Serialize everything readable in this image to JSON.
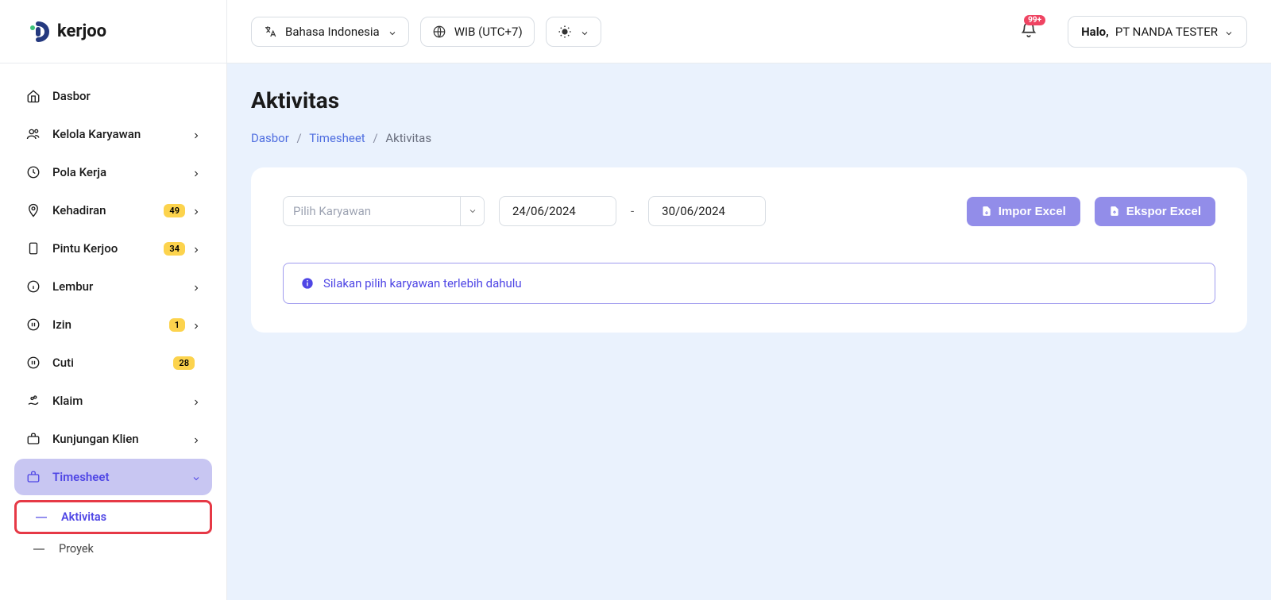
{
  "logo": {
    "text": "kerjoo"
  },
  "sidebar": {
    "items": [
      {
        "label": "Dasbor"
      },
      {
        "label": "Kelola Karyawan"
      },
      {
        "label": "Pola Kerja"
      },
      {
        "label": "Kehadiran",
        "badge": "49"
      },
      {
        "label": "Pintu Kerjoo",
        "badge": "34"
      },
      {
        "label": "Lembur"
      },
      {
        "label": "Izin",
        "badge": "1"
      },
      {
        "label": "Cuti",
        "badge": "28"
      },
      {
        "label": "Klaim"
      },
      {
        "label": "Kunjungan Klien"
      },
      {
        "label": "Timesheet"
      }
    ],
    "sub": {
      "aktivitas": "Aktivitas",
      "proyek": "Proyek"
    }
  },
  "topbar": {
    "language": "Bahasa Indonesia",
    "timezone": "WIB (UTC+7)",
    "notif_badge": "99+",
    "greeting": "Halo,",
    "company": "PT NANDA TESTER"
  },
  "page": {
    "title": "Aktivitas",
    "breadcrumb": {
      "dasbor": "Dasbor",
      "timesheet": "Timesheet",
      "aktivitas": "Aktivitas"
    },
    "filters": {
      "employee_placeholder": "Pilih Karyawan",
      "date_start": "24/06/2024",
      "date_end": "30/06/2024",
      "import_label": "Impor Excel",
      "export_label": "Ekspor Excel"
    },
    "alert": "Silakan pilih karyawan terlebih dahulu"
  }
}
